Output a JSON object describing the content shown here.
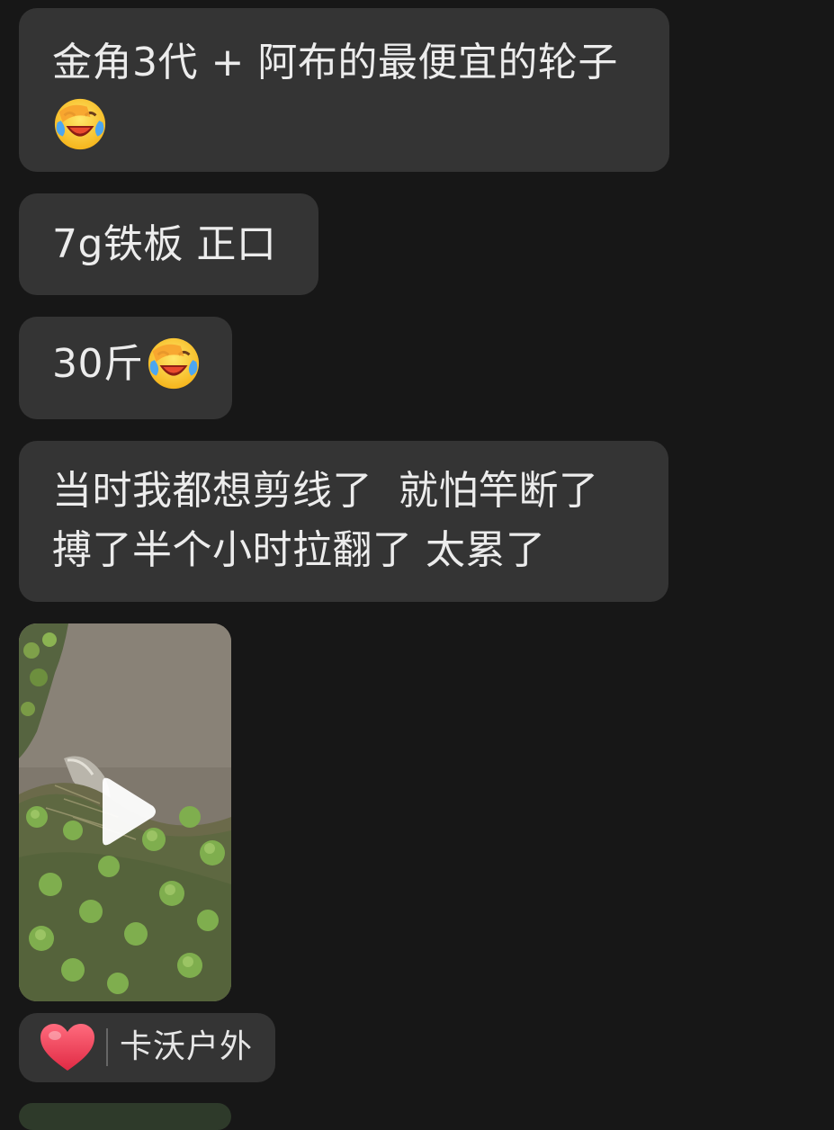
{
  "messages": [
    {
      "lines": [
        "金角3代 + 阿布的最便宜的轮子",
        ""
      ],
      "emoji": "face-with-tears-of-joy-emoji"
    },
    {
      "lines": [
        "7g铁板 正口"
      ]
    },
    {
      "lines": [
        "30斤"
      ],
      "emoji": "face-with-tears-of-joy-emoji"
    },
    {
      "lines": [
        "当时我都想剪线了  就怕竿断了",
        "搏了半个小时拉翻了 太累了"
      ]
    }
  ],
  "video": {
    "icon": "play-icon",
    "thumbnail": "fish-in-water-by-grassy-bank"
  },
  "reaction": {
    "icon": "heart-icon",
    "user": "卡沃户外"
  },
  "colors": {
    "background": "#171717",
    "bubble": "#343434",
    "text": "#ececec",
    "heart": "#e8334a"
  }
}
